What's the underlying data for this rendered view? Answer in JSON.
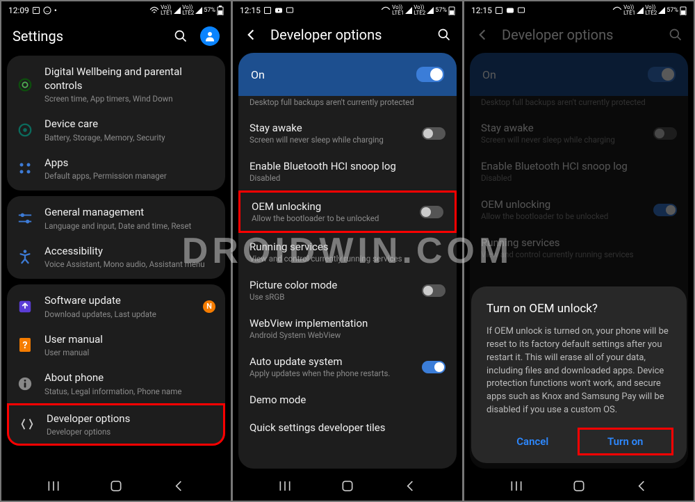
{
  "watermark": "DROIDWIN.COM",
  "status": {
    "time1": "12:09",
    "time2": "12:15",
    "time3": "12:15",
    "battery": "57%",
    "lte1": "Vo))\nLTE1",
    "lte2": "Vo))\nLTE2"
  },
  "s1": {
    "title": "Settings",
    "groups": [
      [
        {
          "icon": "wellbeing",
          "label": "Digital Wellbeing and parental controls",
          "sub": "Screen time, App timers, Wind Down"
        },
        {
          "icon": "devicecare",
          "label": "Device care",
          "sub": "Battery, Storage, Memory, Security"
        },
        {
          "icon": "apps",
          "label": "Apps",
          "sub": "Default apps, Permission manager"
        }
      ],
      [
        {
          "icon": "sliders",
          "label": "General management",
          "sub": "Language and input, Date and time, Reset"
        },
        {
          "icon": "accessibility",
          "label": "Accessibility",
          "sub": "Voice Assistant, Mono audio, Assistant menu"
        }
      ],
      [
        {
          "icon": "update",
          "label": "Software update",
          "sub": "Download updates, Last update",
          "badge": "N"
        },
        {
          "icon": "manual",
          "label": "User manual",
          "sub": "User manual"
        },
        {
          "icon": "info",
          "label": "About phone",
          "sub": "Status, Legal information, Phone name"
        },
        {
          "icon": "dev",
          "label": "Developer options",
          "sub": "Developer options",
          "hl": true
        }
      ]
    ]
  },
  "s2": {
    "title": "Developer options",
    "on_label": "On",
    "cut_top": "Desktop full backups aren't currently protected",
    "rows": [
      {
        "label": "Stay awake",
        "sub": "Screen will never sleep while charging",
        "toggle": "off"
      },
      {
        "label": "Enable Bluetooth HCI snoop log",
        "sub": "Disabled"
      },
      {
        "label": "OEM unlocking",
        "sub": "Allow the bootloader to be unlocked",
        "toggle": "off",
        "hl": true
      },
      {
        "label": "Running services",
        "sub": "View and control currently running services"
      },
      {
        "label": "Picture color mode",
        "sub": "Use sRGB",
        "toggle": "off"
      },
      {
        "label": "WebView implementation",
        "sub": "Android System WebView"
      },
      {
        "label": "Auto update system",
        "sub": "Apply updates when the phone restarts.",
        "toggle": "on"
      },
      {
        "label": "Demo mode"
      },
      {
        "label": "Quick settings developer tiles"
      }
    ]
  },
  "s3": {
    "title": "Developer options",
    "on_label": "On",
    "cut_top": "Desktop full backups aren't currently protected",
    "rows": [
      {
        "label": "Stay awake",
        "sub": "Screen will never sleep while charging",
        "toggle": "off"
      },
      {
        "label": "Enable Bluetooth HCI snoop log",
        "sub": "Disabled"
      },
      {
        "label": "OEM unlocking",
        "sub": "Allow the bootloader to be unlocked",
        "toggle": "on"
      },
      {
        "label": "Running services",
        "sub": "View and control currently running services"
      }
    ],
    "dialog": {
      "title": "Turn on OEM unlock?",
      "body": "If OEM unlock is turned on, your phone will be reset to its factory default settings after you restart it. This will erase all of your data, including files and downloaded apps. Device protection functions won't work, and secure apps such as Knox and Samsung Pay will be disabled if you use a custom OS.",
      "cancel": "Cancel",
      "confirm": "Turn on"
    }
  }
}
